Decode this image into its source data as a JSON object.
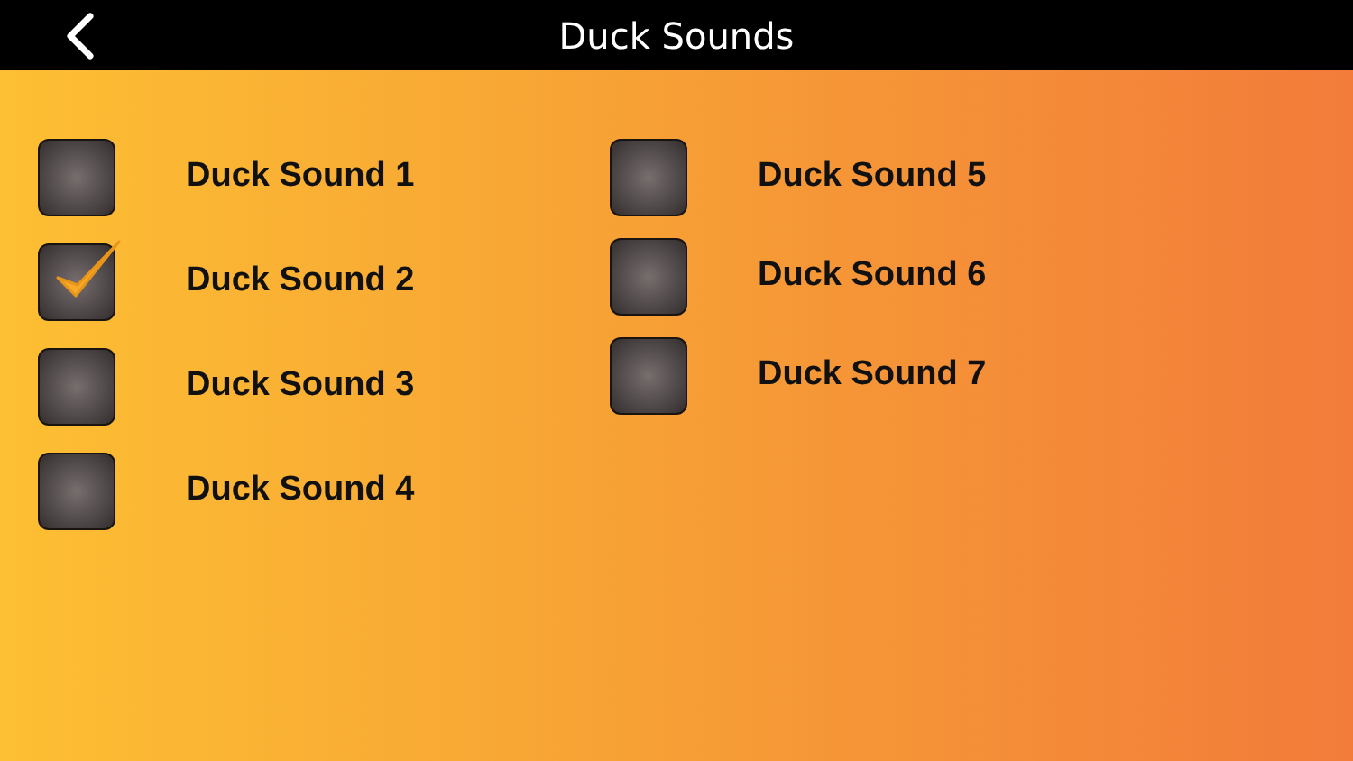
{
  "header": {
    "title": "Duck Sounds"
  },
  "columns": [
    {
      "items": [
        {
          "label": "Duck Sound 1",
          "checked": false
        },
        {
          "label": "Duck Sound 2",
          "checked": true
        },
        {
          "label": "Duck Sound 3",
          "checked": false
        },
        {
          "label": "Duck Sound 4",
          "checked": false
        }
      ]
    },
    {
      "items": [
        {
          "label": "Duck Sound 5",
          "checked": false
        },
        {
          "label": "Duck Sound 6",
          "checked": false
        },
        {
          "label": "Duck Sound 7",
          "checked": false
        }
      ]
    }
  ]
}
